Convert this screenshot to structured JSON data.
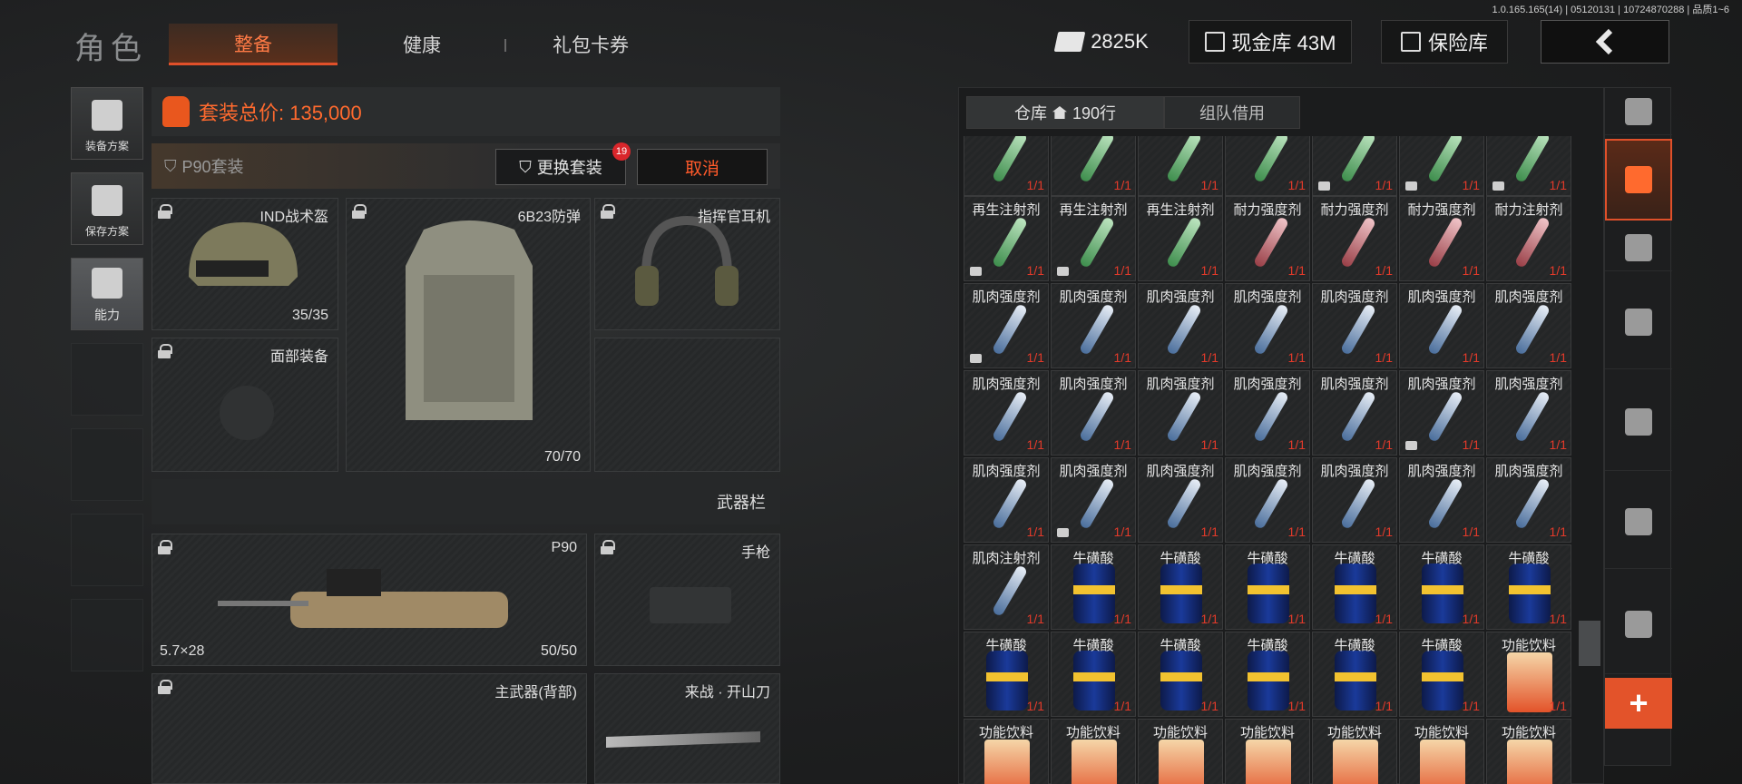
{
  "version": "1.0.165.165(14) | 05120131 | 10724870288 | 品质1~6",
  "header": {
    "title": "角色",
    "tabs": [
      {
        "label": "整备"
      },
      {
        "label": "健康"
      },
      {
        "label": "礼包卡券"
      }
    ],
    "cash": "2825K",
    "vault": "现金库 43M",
    "safe": "保险库"
  },
  "left_nav": [
    {
      "label": "装备方案"
    },
    {
      "label": "保存方案"
    },
    {
      "label": "能力"
    }
  ],
  "loadout": {
    "total_price": "套装总价: 135,000",
    "suit_name": "P90套装",
    "switch_label": "更换套装",
    "switch_badge": "19",
    "cancel_label": "取消",
    "slots": {
      "helmet": {
        "name": "IND战术盔",
        "durability": "35/35"
      },
      "armor": {
        "name": "6B23防弹",
        "durability": "70/70"
      },
      "headset": {
        "name": "指挥官耳机"
      },
      "face": {
        "name": "面部装备"
      }
    },
    "weapon_header": "武器栏",
    "p90": {
      "name": "P90",
      "caliber": "5.7×28",
      "ammo": "50/50"
    },
    "pistol": {
      "name": "手枪"
    },
    "primary_back": {
      "name": "主武器(背部)"
    },
    "melee": {
      "name": "来战 · 开山刀"
    }
  },
  "warehouse": {
    "tabs": [
      {
        "label": "仓库",
        "count": "190行"
      },
      {
        "label": "组队借用"
      }
    ],
    "rows": [
      [
        {
          "n": "",
          "t": "g",
          "q": "1/1"
        },
        {
          "n": "",
          "t": "g",
          "q": "1/1"
        },
        {
          "n": "",
          "t": "g",
          "q": "1/1"
        },
        {
          "n": "",
          "t": "g",
          "q": "1/1"
        },
        {
          "n": "",
          "t": "g",
          "q": "1/1",
          "f": 1
        },
        {
          "n": "",
          "t": "g",
          "q": "1/1",
          "f": 1
        },
        {
          "n": "",
          "t": "g",
          "q": "1/1",
          "f": 1
        }
      ],
      [
        {
          "n": "再生注射剂",
          "t": "g",
          "q": "1/1",
          "f": 1
        },
        {
          "n": "再生注射剂",
          "t": "g",
          "q": "1/1",
          "f": 1
        },
        {
          "n": "再生注射剂",
          "t": "g",
          "q": "1/1"
        },
        {
          "n": "耐力强度剂",
          "t": "r",
          "q": "1/1"
        },
        {
          "n": "耐力强度剂",
          "t": "r",
          "q": "1/1"
        },
        {
          "n": "耐力强度剂",
          "t": "r",
          "q": "1/1"
        },
        {
          "n": "耐力注射剂",
          "t": "r",
          "q": "1/1"
        }
      ],
      [
        {
          "n": "肌肉强度剂",
          "t": "b",
          "q": "1/1",
          "f": 1
        },
        {
          "n": "肌肉强度剂",
          "t": "b",
          "q": "1/1"
        },
        {
          "n": "肌肉强度剂",
          "t": "b",
          "q": "1/1"
        },
        {
          "n": "肌肉强度剂",
          "t": "b",
          "q": "1/1"
        },
        {
          "n": "肌肉强度剂",
          "t": "b",
          "q": "1/1"
        },
        {
          "n": "肌肉强度剂",
          "t": "b",
          "q": "1/1"
        },
        {
          "n": "肌肉强度剂",
          "t": "b",
          "q": "1/1"
        }
      ],
      [
        {
          "n": "肌肉强度剂",
          "t": "b",
          "q": "1/1"
        },
        {
          "n": "肌肉强度剂",
          "t": "b",
          "q": "1/1"
        },
        {
          "n": "肌肉强度剂",
          "t": "b",
          "q": "1/1"
        },
        {
          "n": "肌肉强度剂",
          "t": "b",
          "q": "1/1"
        },
        {
          "n": "肌肉强度剂",
          "t": "b",
          "q": "1/1"
        },
        {
          "n": "肌肉强度剂",
          "t": "b",
          "q": "1/1",
          "f": 1
        },
        {
          "n": "肌肉强度剂",
          "t": "b",
          "q": "1/1"
        }
      ],
      [
        {
          "n": "肌肉强度剂",
          "t": "b",
          "q": "1/1"
        },
        {
          "n": "肌肉强度剂",
          "t": "b",
          "q": "1/1",
          "f": 1
        },
        {
          "n": "肌肉强度剂",
          "t": "b",
          "q": "1/1"
        },
        {
          "n": "肌肉强度剂",
          "t": "b",
          "q": "1/1"
        },
        {
          "n": "肌肉强度剂",
          "t": "b",
          "q": "1/1"
        },
        {
          "n": "肌肉强度剂",
          "t": "b",
          "q": "1/1"
        },
        {
          "n": "肌肉强度剂",
          "t": "b",
          "q": "1/1"
        }
      ],
      [
        {
          "n": "肌肉注射剂",
          "t": "b",
          "q": "1/1"
        },
        {
          "n": "牛磺酸",
          "t": "c",
          "q": "1/1"
        },
        {
          "n": "牛磺酸",
          "t": "c",
          "q": "1/1"
        },
        {
          "n": "牛磺酸",
          "t": "c",
          "q": "1/1"
        },
        {
          "n": "牛磺酸",
          "t": "c",
          "q": "1/1"
        },
        {
          "n": "牛磺酸",
          "t": "c",
          "q": "1/1"
        },
        {
          "n": "牛磺酸",
          "t": "c",
          "q": "1/1"
        }
      ],
      [
        {
          "n": "牛磺酸",
          "t": "c",
          "q": "1/1"
        },
        {
          "n": "牛磺酸",
          "t": "c",
          "q": "1/1"
        },
        {
          "n": "牛磺酸",
          "t": "c",
          "q": "1/1"
        },
        {
          "n": "牛磺酸",
          "t": "c",
          "q": "1/1"
        },
        {
          "n": "牛磺酸",
          "t": "c",
          "q": "1/1"
        },
        {
          "n": "牛磺酸",
          "t": "c",
          "q": "1/1"
        },
        {
          "n": "功能饮料",
          "t": "d",
          "q": "1/1"
        }
      ],
      [
        {
          "n": "功能饮料",
          "t": "d",
          "q": ""
        },
        {
          "n": "功能饮料",
          "t": "d",
          "q": ""
        },
        {
          "n": "功能饮料",
          "t": "d",
          "q": ""
        },
        {
          "n": "功能饮料",
          "t": "d",
          "q": ""
        },
        {
          "n": "功能饮料",
          "t": "d",
          "q": ""
        },
        {
          "n": "功能饮料",
          "t": "d",
          "q": ""
        },
        {
          "n": "功能饮料",
          "t": "d",
          "q": ""
        }
      ]
    ]
  },
  "right_nav": [
    {
      "icon": "stack-refresh-icon"
    },
    {
      "icon": "layers-icon"
    },
    {
      "icon": "vest-icon"
    },
    {
      "icon": "rifle-icon"
    },
    {
      "icon": "magazine-icon"
    },
    {
      "icon": "bullet-icon"
    },
    {
      "icon": "scope-icon"
    },
    {
      "icon": "plus-icon"
    }
  ],
  "colors": {
    "accent": "#e0502a",
    "quantity": "#e23a2a"
  }
}
